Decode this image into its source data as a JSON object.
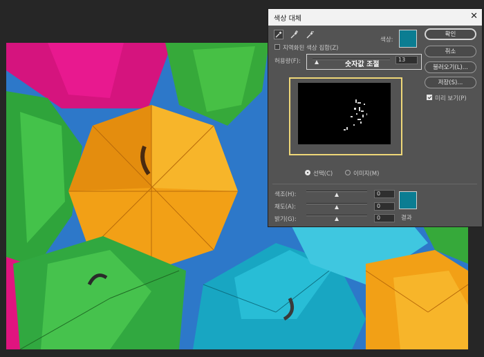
{
  "dialog": {
    "title": "색상 대체",
    "close_glyph": "✕",
    "localized_clusters_label": "지역화된 색상 집합(Z)",
    "color_label": "색상:",
    "fuzziness_label": "허용량(F):",
    "fuzziness_value": "13",
    "fuzziness_level": 0.06,
    "tooltip": "숫자값 조절",
    "view_mode": {
      "selection_label": "선택(C)",
      "image_label": "이미지(M)",
      "selected": "selection"
    },
    "replacement": {
      "hue_label": "색조(H):",
      "hue_value": "0",
      "saturation_label": "채도(A):",
      "saturation_value": "0",
      "lightness_label": "밝기(G):",
      "lightness_value": "0",
      "result_label": "결과"
    },
    "buttons": {
      "ok": "확인",
      "cancel": "취소",
      "load": "불러오기(L)...",
      "save": "저장(S)..."
    },
    "preview_label": "미리 보기(P)",
    "preview_checked": true,
    "localized_checked": false
  },
  "colors": {
    "sample_color": "#0b7d92",
    "result_color": "#0b7d92",
    "highlight_border": "#f0d878"
  },
  "icons": [
    "eyedropper-icon",
    "eyedropper-plus-icon",
    "eyedropper-minus-icon"
  ]
}
